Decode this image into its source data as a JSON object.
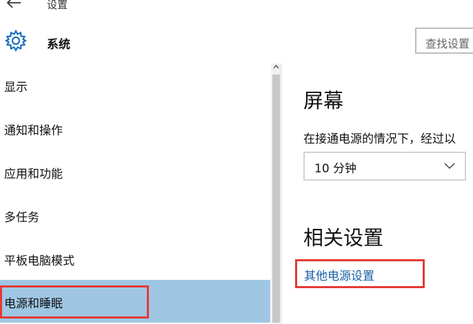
{
  "header": {
    "back_icon": "back-arrow-icon",
    "app_title": "设置",
    "section_icon": "gear-icon",
    "section_title": "系统",
    "search_placeholder": "查找设置"
  },
  "sidebar": {
    "items": [
      {
        "label": "显示",
        "selected": false
      },
      {
        "label": "通知和操作",
        "selected": false
      },
      {
        "label": "应用和功能",
        "selected": false
      },
      {
        "label": "多任务",
        "selected": false
      },
      {
        "label": "平板电脑模式",
        "selected": false
      },
      {
        "label": "电源和睡眠",
        "selected": true
      }
    ]
  },
  "content": {
    "screen_heading": "屏幕",
    "screen_desc": "在接通电源的情况下，经过以",
    "screen_select_value": "10 分钟",
    "related_heading": "相关设置",
    "related_link": "其他电源设置"
  },
  "colors": {
    "selected_bg": "#9fc7e4",
    "link": "#1a5fa6",
    "annotation_red": "#e53935"
  }
}
